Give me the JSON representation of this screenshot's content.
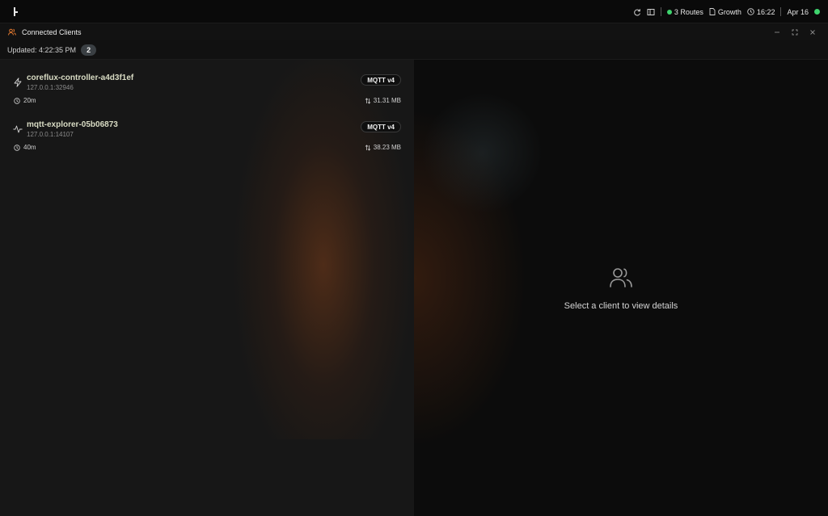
{
  "topbar": {
    "routes_label": "3 Routes",
    "growth_label": "Growth",
    "time": "16:22",
    "date": "Apr 16",
    "status_color": "#3fd46e"
  },
  "panel": {
    "title": "Connected Clients",
    "icon": "users-icon",
    "accent": "#e0782f"
  },
  "status": {
    "updated": "Updated: 4:22:35 PM",
    "count": "2"
  },
  "clients": [
    {
      "name": "coreflux-controller-a4d3f1ef",
      "address": "127.0.0.1:32946",
      "protocol": "MQTT v4",
      "duration": "20m",
      "transfer": "31.31 MB",
      "icon": "bolt-icon"
    },
    {
      "name": "mqtt-explorer-05b06873",
      "address": "127.0.0.1:14107",
      "protocol": "MQTT v4",
      "duration": "40m",
      "transfer": "38.23 MB",
      "icon": "activity-icon"
    }
  ],
  "detail": {
    "empty_message": "Select a client to view details"
  }
}
